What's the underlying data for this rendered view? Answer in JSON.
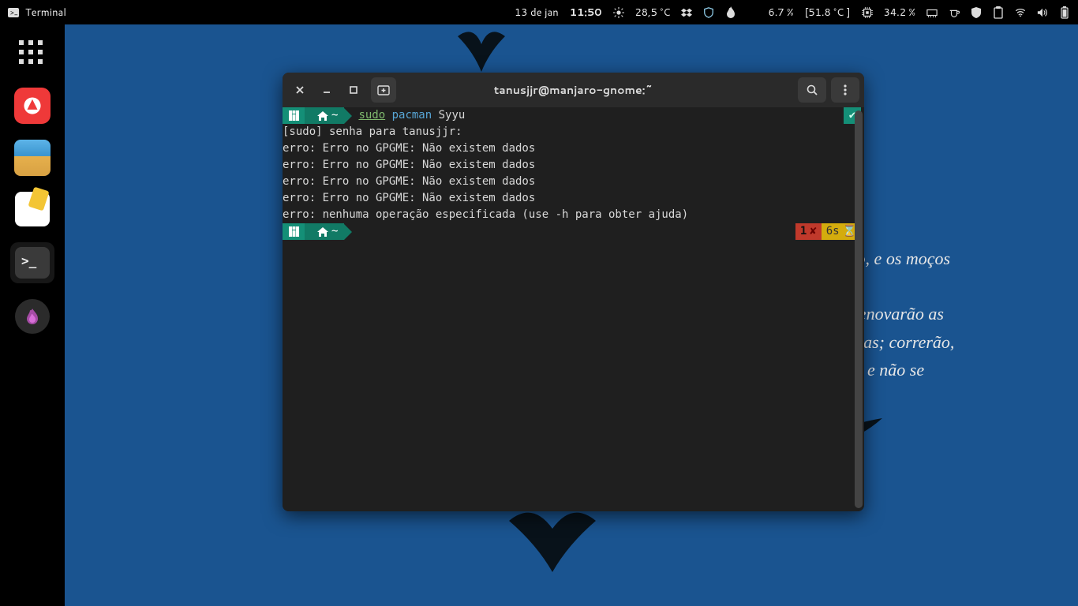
{
  "topbar": {
    "app_label": "Terminal",
    "date": "13 de jan",
    "time": "11:50",
    "weather_temp": "28,5 °C",
    "cpu_pct": "6.7 %",
    "cpu_temp": "[51.8 °C ]",
    "mem_pct": "34.2 %"
  },
  "dash": {
    "items": [
      {
        "name": "apps-grid"
      },
      {
        "name": "vivaldi"
      },
      {
        "name": "files"
      },
      {
        "name": "notes"
      },
      {
        "name": "terminal",
        "active": true
      },
      {
        "name": "flameshot"
      }
    ]
  },
  "window": {
    "title": "tanusjjr@manjaro-gnome:~"
  },
  "terminal": {
    "prompt_home": "~",
    "cmd_sudo": "sudo",
    "cmd_pacman": "pacman",
    "cmd_args": "Syyu",
    "sudo_prompt": "[sudo] senha para tanusjjr:",
    "errors": [
      "erro: Erro no GPGME: Não existem dados",
      "erro: Erro no GPGME: Não existem dados",
      "erro: Erro no GPGME: Não existem dados",
      "erro: Erro no GPGME: Não existem dados",
      "erro: nenhuma operação especificada (use -h para obter ajuda)"
    ],
    "status_ok": "✔",
    "status_err_code": "1",
    "status_err_x": "✘",
    "status_time": "6s",
    "status_hourglass": "⌛"
  },
  "desktop": {
    "line1": "rão, e os moços",
    "line2": ";",
    "line3": "r renovarão as",
    "line4": "guias; correrão,",
    "line5": "ão, e não se"
  }
}
